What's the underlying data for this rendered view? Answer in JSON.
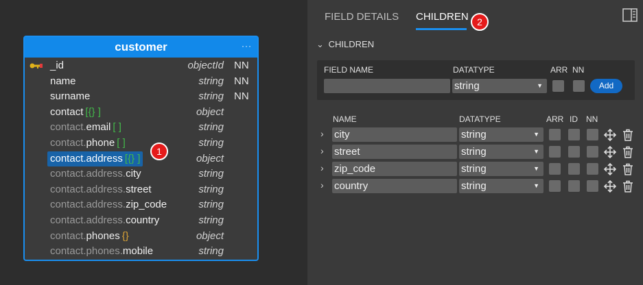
{
  "entity": {
    "title": "customer",
    "menu_label": "···",
    "fields": [
      {
        "parent": "",
        "leaf": "_id",
        "bracket": "",
        "bracket_kind": "",
        "type": "objectId",
        "nn": "NN",
        "key": true
      },
      {
        "parent": "",
        "leaf": "name",
        "bracket": "",
        "bracket_kind": "",
        "type": "string",
        "nn": "NN"
      },
      {
        "parent": "",
        "leaf": "surname",
        "bracket": "",
        "bracket_kind": "",
        "type": "string",
        "nn": "NN"
      },
      {
        "parent": "",
        "leaf": "contact",
        "bracket": "[{} ]",
        "bracket_kind": "objarr",
        "type": "object",
        "nn": ""
      },
      {
        "parent": "contact.",
        "leaf": "email",
        "bracket": "[ ]",
        "bracket_kind": "arr",
        "type": "string",
        "nn": ""
      },
      {
        "parent": "contact.",
        "leaf": "phone",
        "bracket": "[ ]",
        "bracket_kind": "arr",
        "type": "string",
        "nn": ""
      },
      {
        "parent": "contact.",
        "leaf": "address",
        "bracket": "[{} ]",
        "bracket_kind": "objarr",
        "type": "object",
        "nn": "",
        "selected": true
      },
      {
        "parent": "contact.address.",
        "leaf": "city",
        "bracket": "",
        "bracket_kind": "",
        "type": "string",
        "nn": ""
      },
      {
        "parent": "contact.address.",
        "leaf": "street",
        "bracket": "",
        "bracket_kind": "",
        "type": "string",
        "nn": ""
      },
      {
        "parent": "contact.address.",
        "leaf": "zip_code",
        "bracket": "",
        "bracket_kind": "",
        "type": "string",
        "nn": ""
      },
      {
        "parent": "contact.address.",
        "leaf": "country",
        "bracket": "",
        "bracket_kind": "",
        "type": "string",
        "nn": ""
      },
      {
        "parent": "contact.",
        "leaf": "phones",
        "bracket": "{}",
        "bracket_kind": "obj",
        "type": "object",
        "nn": ""
      },
      {
        "parent": "contact.phones.",
        "leaf": "mobile",
        "bracket": "",
        "bracket_kind": "",
        "type": "string",
        "nn": ""
      }
    ]
  },
  "badges": {
    "one": "1",
    "two": "2"
  },
  "tabs": {
    "field_details": "FIELD DETAILS",
    "children": "CHILDREN"
  },
  "section": {
    "title": "CHILDREN"
  },
  "add_form": {
    "field_name_label": "FIELD NAME",
    "datatype_label": "DATATYPE",
    "arr_label": "ARR",
    "nn_label": "NN",
    "field_name_value": "",
    "datatype_value": "string",
    "add_button": "Add"
  },
  "children_table": {
    "headers": {
      "name": "NAME",
      "datatype": "DATATYPE",
      "arr": "ARR",
      "id": "ID",
      "nn": "NN"
    },
    "rows": [
      {
        "name": "city",
        "datatype": "string"
      },
      {
        "name": "street",
        "datatype": "string"
      },
      {
        "name": "zip_code",
        "datatype": "string"
      },
      {
        "name": "country",
        "datatype": "string"
      }
    ]
  },
  "icons": [
    "key-icon",
    "menu-dots-icon",
    "panel-toggle-icon",
    "chevron-down-icon",
    "chevron-right-icon",
    "move-icon",
    "trash-icon",
    "caret-down-icon"
  ],
  "colors": {
    "accent": "#1289ea",
    "badge": "#e51b1b",
    "object_bracket": "#d9a236",
    "array_bracket": "#43b94a",
    "selection": "#1863a8"
  }
}
